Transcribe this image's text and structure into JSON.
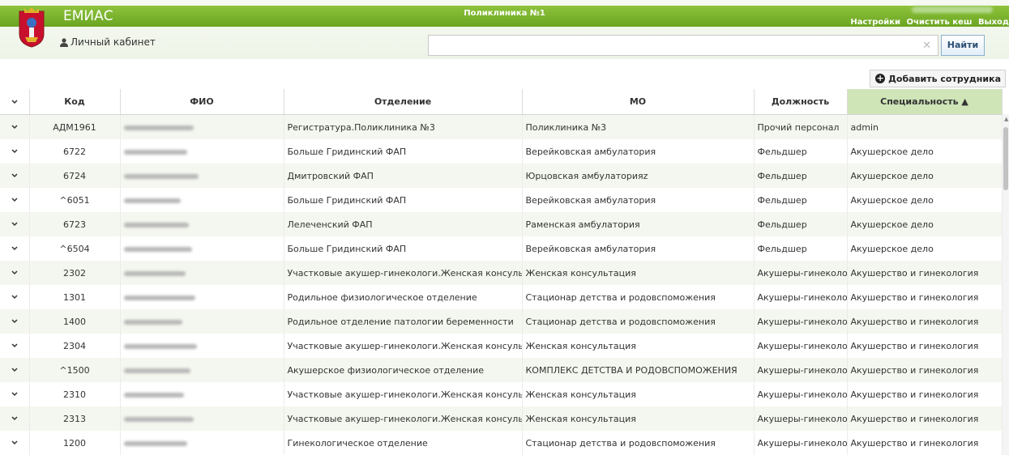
{
  "header": {
    "app_title": "ЕМИАС",
    "clinic": "Поликлиника №1",
    "settings_link": "Настройки",
    "clear_cache_link": "Очистить кеш",
    "logout_link": "Выход",
    "cabinet_label": "Личный кабинет"
  },
  "search": {
    "value": "",
    "placeholder": "",
    "button_label": "Найти"
  },
  "toolbar": {
    "add_employee_label": "Добавить сотрудника"
  },
  "table": {
    "columns": [
      "Код",
      "ФИО",
      "Отделение",
      "МО",
      "Должность",
      "Специальность ▲"
    ],
    "rows": [
      {
        "code": "АДМ1961",
        "dept": "Регистратура.Поликлиника №3",
        "mo": "Поликлиника №3",
        "position": "Прочий персонал",
        "specialty": "admin"
      },
      {
        "code": "6722",
        "dept": "Больше Гридинский ФАП",
        "mo": "Верейковская амбулатория",
        "position": "Фельдшер",
        "specialty": "Акушерское дело"
      },
      {
        "code": "6724",
        "dept": "Дмитровский ФАП",
        "mo": "Юрцовская амбулаторияz",
        "position": "Фельдшер",
        "specialty": "Акушерское дело"
      },
      {
        "code": "^6051",
        "dept": "Больше Гридинский ФАП",
        "mo": "Верейковская амбулатория",
        "position": "Фельдшер",
        "specialty": "Акушерское дело"
      },
      {
        "code": "6723",
        "dept": "Лелеченский ФАП",
        "mo": "Раменская амбулатория",
        "position": "Фельдшер",
        "specialty": "Акушерское дело"
      },
      {
        "code": "^6504",
        "dept": "Больше Гридинский ФАП",
        "mo": "Верейковская амбулатория",
        "position": "Фельдшер",
        "specialty": "Акушерское дело"
      },
      {
        "code": "2302",
        "dept": "Участковые акушер-гинекологи.Женская консультация",
        "mo": "Женская консультация",
        "position": "Акушеры-гинекологи",
        "specialty": "Акушерство и гинекология"
      },
      {
        "code": "1301",
        "dept": "Родильное физиологическое отделение",
        "mo": "Стационар детства и родовспоможения",
        "position": "Акушеры-гинекологи",
        "specialty": "Акушерство и гинекология"
      },
      {
        "code": "1400",
        "dept": "Родильное отделение патологии беременности",
        "mo": "Стационар детства и родовспоможения",
        "position": "Акушеры-гинекологи",
        "specialty": "Акушерство и гинекология"
      },
      {
        "code": "2304",
        "dept": "Участковые акушер-гинекологи.Женская консультация",
        "mo": "Женская консультация",
        "position": "Акушеры-гинекологи",
        "specialty": "Акушерство и гинекология"
      },
      {
        "code": "^1500",
        "dept": "Акушерское физиологическое отделение",
        "mo": "КОМПЛЕКС ДЕТСТВА И РОДОВСПОМОЖЕНИЯ",
        "position": "Акушеры-гинекологи",
        "specialty": "Акушерство и гинекология"
      },
      {
        "code": "2310",
        "dept": "Участковые акушер-гинекологи.Женская консультация",
        "mo": "Женская консультация",
        "position": "Акушеры-гинекологи",
        "specialty": "Акушерство и гинекология"
      },
      {
        "code": "2313",
        "dept": "Участковые акушер-гинекологи.Женская консультация",
        "mo": "Женская консультация",
        "position": "Акушеры-гинекологи",
        "specialty": "Акушерство и гинекология"
      },
      {
        "code": "1200",
        "dept": "Гинекологическое отделение",
        "mo": "Стационар детства и родовспоможения",
        "position": "Акушеры-гинекологи",
        "specialty": "Акушерство и гинекология"
      }
    ]
  },
  "icons": {
    "expand": "chevron-down-icon",
    "user": "user-icon",
    "add": "plus-circle-icon",
    "clear": "close-icon"
  },
  "colors": {
    "header_green": "#7ab52e",
    "sorted_header": "#cfe5b8",
    "row_alt": "#f4f7ef"
  }
}
